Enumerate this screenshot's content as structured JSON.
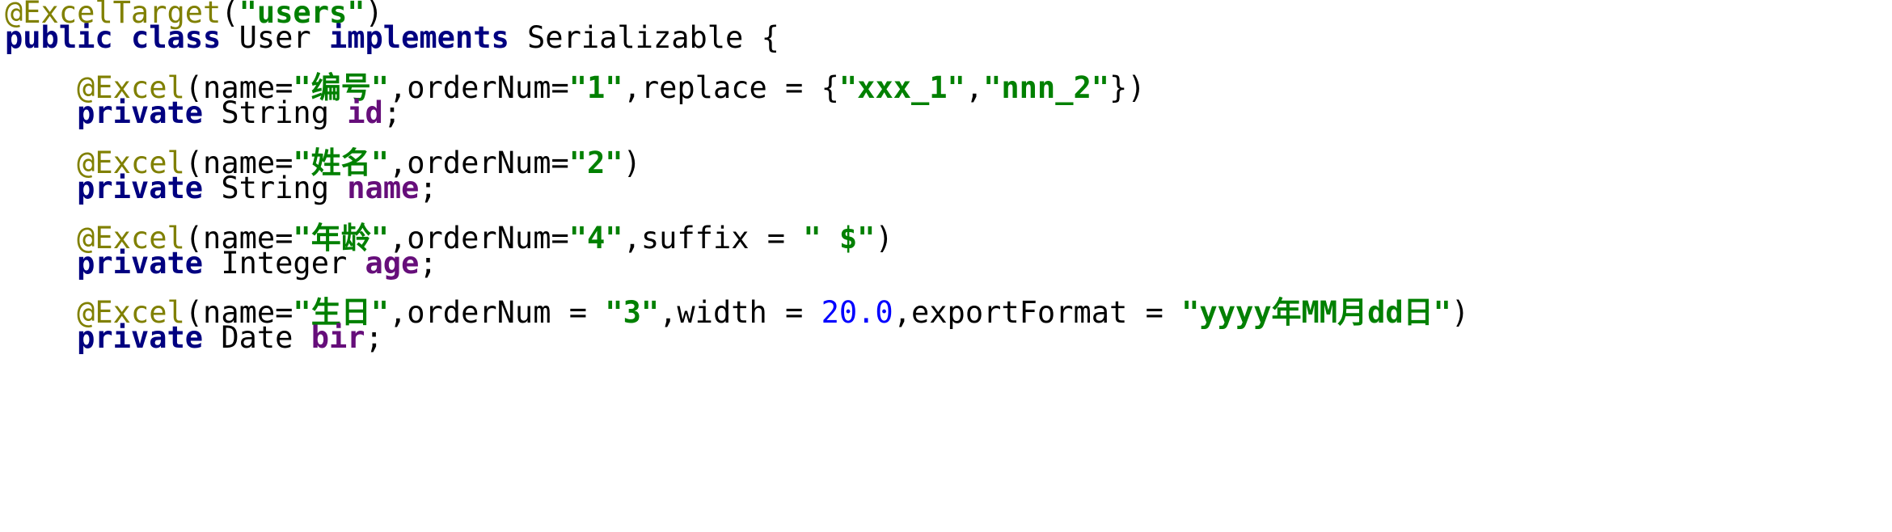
{
  "editor": {
    "language": "java",
    "colors": {
      "annotation": "#808000",
      "keyword": "#000080",
      "string": "#008000",
      "field": "#660e7a",
      "number": "#0000ff",
      "plain": "#000000",
      "background": "#ffffff"
    },
    "lines": [
      [
        {
          "t": "@ExcelTarget",
          "k": "annotation"
        },
        {
          "t": "(",
          "k": "plain"
        },
        {
          "t": "\"users\"",
          "k": "string"
        },
        {
          "t": ")",
          "k": "plain"
        }
      ],
      [
        {
          "t": "public",
          "k": "keyword"
        },
        {
          "t": " ",
          "k": "plain"
        },
        {
          "t": "class",
          "k": "keyword"
        },
        {
          "t": " User ",
          "k": "plain"
        },
        {
          "t": "implements",
          "k": "keyword"
        },
        {
          "t": " Serializable {",
          "k": "plain"
        }
      ],
      [],
      [
        {
          "t": "    ",
          "k": "plain"
        },
        {
          "t": "@Excel",
          "k": "annotation"
        },
        {
          "t": "(name=",
          "k": "plain"
        },
        {
          "t": "\"编号\"",
          "k": "string"
        },
        {
          "t": ",orderNum=",
          "k": "plain"
        },
        {
          "t": "\"1\"",
          "k": "string"
        },
        {
          "t": ",replace = {",
          "k": "plain"
        },
        {
          "t": "\"xxx_1\"",
          "k": "string"
        },
        {
          "t": ",",
          "k": "plain"
        },
        {
          "t": "\"nnn_2\"",
          "k": "string"
        },
        {
          "t": "})",
          "k": "plain"
        }
      ],
      [
        {
          "t": "    ",
          "k": "plain"
        },
        {
          "t": "private",
          "k": "keyword"
        },
        {
          "t": " String ",
          "k": "plain"
        },
        {
          "t": "id",
          "k": "field"
        },
        {
          "t": ";",
          "k": "plain"
        }
      ],
      [],
      [
        {
          "t": "    ",
          "k": "plain"
        },
        {
          "t": "@Excel",
          "k": "annotation"
        },
        {
          "t": "(name=",
          "k": "plain"
        },
        {
          "t": "\"姓名\"",
          "k": "string"
        },
        {
          "t": ",orderNum=",
          "k": "plain"
        },
        {
          "t": "\"2\"",
          "k": "string"
        },
        {
          "t": ")",
          "k": "plain"
        }
      ],
      [
        {
          "t": "    ",
          "k": "plain"
        },
        {
          "t": "private",
          "k": "keyword"
        },
        {
          "t": " String ",
          "k": "plain"
        },
        {
          "t": "name",
          "k": "field"
        },
        {
          "t": ";",
          "k": "plain"
        }
      ],
      [],
      [
        {
          "t": "    ",
          "k": "plain"
        },
        {
          "t": "@Excel",
          "k": "annotation"
        },
        {
          "t": "(name=",
          "k": "plain"
        },
        {
          "t": "\"年龄\"",
          "k": "string"
        },
        {
          "t": ",orderNum=",
          "k": "plain"
        },
        {
          "t": "\"4\"",
          "k": "string"
        },
        {
          "t": ",suffix = ",
          "k": "plain"
        },
        {
          "t": "\" $\"",
          "k": "string"
        },
        {
          "t": ")",
          "k": "plain"
        }
      ],
      [
        {
          "t": "    ",
          "k": "plain"
        },
        {
          "t": "private",
          "k": "keyword"
        },
        {
          "t": " Integer ",
          "k": "plain"
        },
        {
          "t": "age",
          "k": "field"
        },
        {
          "t": ";",
          "k": "plain"
        }
      ],
      [],
      [
        {
          "t": "    ",
          "k": "plain"
        },
        {
          "t": "@Excel",
          "k": "annotation"
        },
        {
          "t": "(name=",
          "k": "plain"
        },
        {
          "t": "\"生日\"",
          "k": "string"
        },
        {
          "t": ",orderNum = ",
          "k": "plain"
        },
        {
          "t": "\"3\"",
          "k": "string"
        },
        {
          "t": ",width = ",
          "k": "plain"
        },
        {
          "t": "20.0",
          "k": "number"
        },
        {
          "t": ",exportFormat = ",
          "k": "plain"
        },
        {
          "t": "\"yyyy年MM月dd日\"",
          "k": "string"
        },
        {
          "t": ")",
          "k": "plain"
        }
      ],
      [
        {
          "t": "    ",
          "k": "plain"
        },
        {
          "t": "private",
          "k": "keyword"
        },
        {
          "t": " Date ",
          "k": "plain"
        },
        {
          "t": "bir",
          "k": "field"
        },
        {
          "t": ";",
          "k": "plain"
        }
      ]
    ]
  }
}
